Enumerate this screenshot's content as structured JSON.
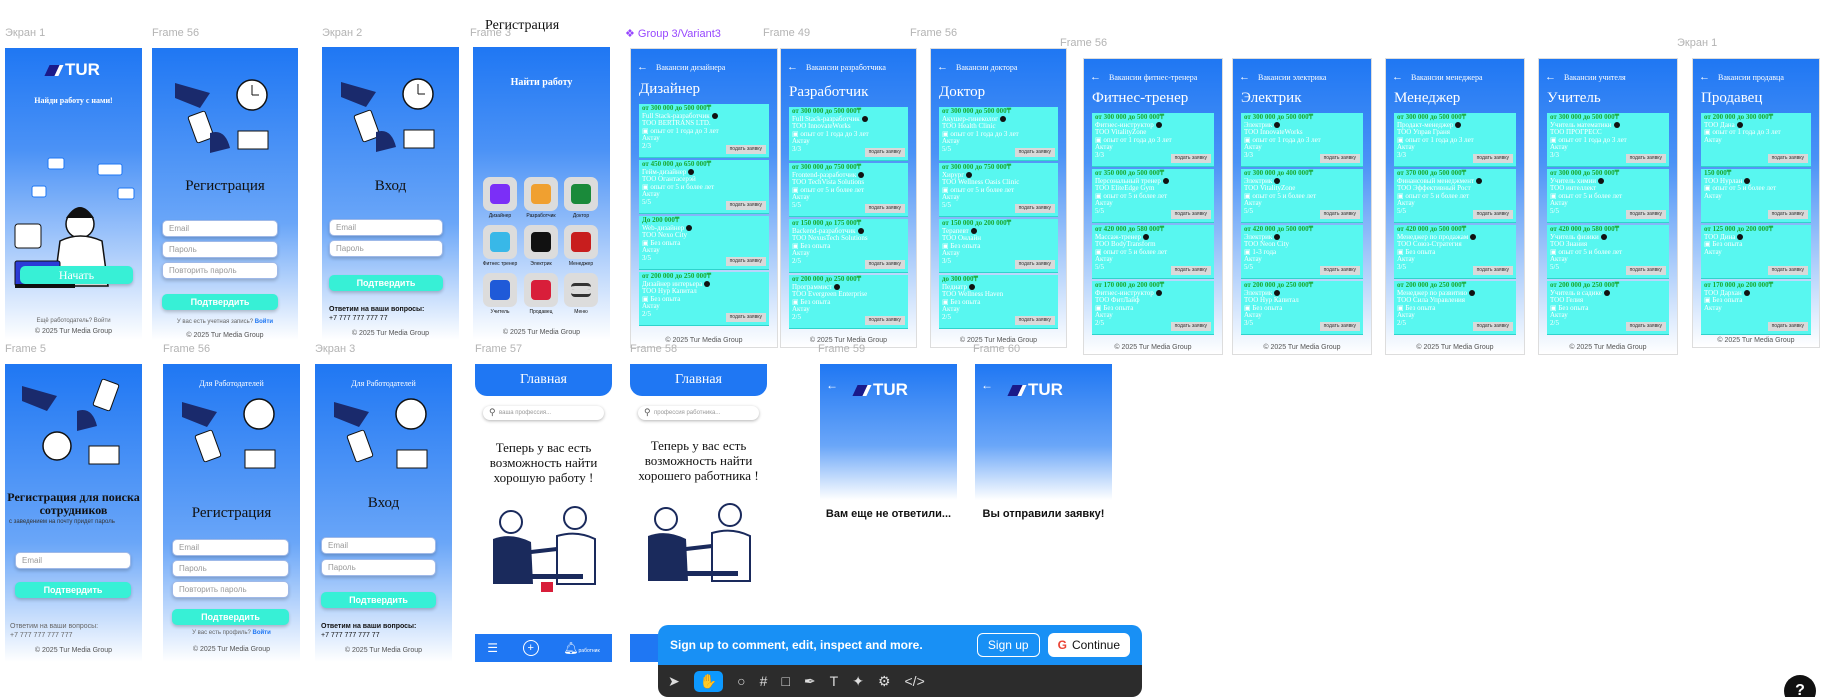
{
  "labels": {
    "ekran1": "Экран 1",
    "frame56a": "Frame 56",
    "ekran2": "Экран 2",
    "frame3": "Frame 3",
    "registration_top": "Регистрация",
    "group3": "❖ Group 3/Variant3",
    "frame49": "Frame 49",
    "frame56b": "Frame 56",
    "frame56c": "Frame 56",
    "ekran1b": "Экран 1",
    "frame5": "Frame 5",
    "frame56d": "Frame 56",
    "ekran3": "Экран 3",
    "frame57": "Frame 57",
    "frame58": "Frame 58",
    "frame59": "Frame 59",
    "frame60": "Frame 60"
  },
  "welcome": {
    "logo": "TUR",
    "headline": "Найди работу с нами!",
    "start": "Начать",
    "footnote": "Ещё работодатель? Войти",
    "copyright": "© 2025 Tur Media Group"
  },
  "register1": {
    "title": "Регистрация",
    "email": "Email",
    "password": "Пароль",
    "repeat": "Повторить пароль",
    "confirm": "Подтвердить",
    "have_account": "У вас есть учетная запись?",
    "login_link": "Войти",
    "copyright": "© 2025 Tur Media Group"
  },
  "login1": {
    "title": "Вход",
    "email": "Email",
    "password": "Пароль",
    "confirm": "Подтвердить",
    "contact": "Ответим на ваши вопросы:",
    "phone": "+7 777 777 777 77",
    "copyright": "© 2025 Tur Media Group"
  },
  "categories": {
    "find": "Найти работу",
    "items": [
      {
        "label": "Дизайнер",
        "icon": "pencil-ruler-icon",
        "color": "#7b2ff7"
      },
      {
        "label": "Разработчик",
        "icon": "code-icon",
        "color": "#f0a030"
      },
      {
        "label": "Доктор",
        "icon": "stethoscope-icon",
        "color": "#1a8a3a"
      },
      {
        "label": "Фитнес тренер",
        "icon": "dumbbell-icon",
        "color": "#38b8e8"
      },
      {
        "label": "Электрик",
        "icon": "switch-icon",
        "color": "#111111"
      },
      {
        "label": "Менеджер",
        "icon": "bank-icon",
        "color": "#c81e1e"
      },
      {
        "label": "Учитель",
        "icon": "teacher-icon",
        "color": "#1f5ad8"
      },
      {
        "label": "Продавец",
        "icon": "receipt-icon",
        "color": "#d81e3a"
      },
      {
        "label": "Меню",
        "icon": "menu-icon",
        "color": "#333333"
      }
    ],
    "copyright": "© 2025 Tur Media Group"
  },
  "jobs": [
    {
      "header": "Вакансии дизайнера",
      "title": "Дизайнер",
      "cards": [
        {
          "salary": "от 300 000 до 500 000₸",
          "role": "Full Stack-разработчик",
          "company": "ТОО BERTRANS LTD.",
          "exp": "опыт от 1 года до 3 лет",
          "city": "Актау",
          "count": "2/3"
        },
        {
          "salary": "от 450 000 до 650 000₸",
          "role": "Гейм-дизайнер",
          "company": "ТОО Огантасерэй",
          "exp": "опыт от 5 и более лет",
          "city": "Актау",
          "count": "5/5"
        },
        {
          "salary": "До 200 000₸",
          "role": "Web-дизайнер",
          "company": "ТОО Nexo City",
          "exp": "Без опыта",
          "city": "Актау",
          "count": "3/5"
        },
        {
          "salary": "от 200 000 до 250 000₸",
          "role": "Дизайнер интерьера",
          "company": "ТОО Нур Капитал",
          "exp": "Без опыта",
          "city": "Актау",
          "count": "2/5"
        }
      ]
    },
    {
      "header": "Вакансии разработчика",
      "title": "Разработчик",
      "cards": [
        {
          "salary": "от 300 000 до 500 000₸",
          "role": "Full Stack-разработчик",
          "company": "ТОО InnovateWorks",
          "exp": "опыт от 1 года до 3 лет",
          "city": "Актау",
          "count": "3/3"
        },
        {
          "salary": "от 300 000 до 750 000₸",
          "role": "Frontend-разработчик",
          "company": "ТОО TechVista Solutions",
          "exp": "опыт от 5 и более лет",
          "city": "Актау",
          "count": "5/5"
        },
        {
          "salary": "от 150 000 до 175 000₸",
          "role": "Backend-разработчик",
          "company": "ТОО NexusTech Solutions",
          "exp": "Без опыта",
          "city": "Актау",
          "count": "2/5"
        },
        {
          "salary": "от 200 000 до 250 000₸",
          "role": "Программист",
          "company": "ТОО Evergreen Enterprise",
          "exp": "Без опыта",
          "city": "Актау",
          "count": "2/5"
        }
      ]
    },
    {
      "header": "Вакансии доктора",
      "title": "Доктор",
      "cards": [
        {
          "salary": "от 300 000 до 500 000₸",
          "role": "Акушер-гинеколог",
          "company": "ТОО Health Clinic",
          "exp": "опыт от 1 года до 3 лет",
          "city": "Актау",
          "count": "5/5"
        },
        {
          "salary": "от 300 000 до 750 000₸",
          "role": "Хирург",
          "company": "ТОО Wellness Oasis Clinic",
          "exp": "опыт от 5 и более лет",
          "city": "Актау",
          "count": "5/5"
        },
        {
          "salary": "от 150 000 до 200 000₸",
          "role": "Терапевт",
          "company": "ТОО Онлайн",
          "exp": "Без опыта",
          "city": "Актау",
          "count": "3/5"
        },
        {
          "salary": "до 300 000₸",
          "role": "Педиатр",
          "company": "ТОО Wellness Haven",
          "exp": "Без опыта",
          "city": "Актау",
          "count": "2/5"
        }
      ]
    },
    {
      "header": "Вакансии фитнес-тренера",
      "title": "Фитнес-тренер",
      "cards": [
        {
          "salary": "от 300 000 до 500 000₸",
          "role": "Фитнес-инструктор",
          "company": "ТОО VitalityZone",
          "exp": "опыт от 1 года до 3 лет",
          "city": "Актау",
          "count": "3/3"
        },
        {
          "salary": "от 350 000 до 500 000₸",
          "role": "Персональный тренер",
          "company": "ТОО EliteEdge Gym",
          "exp": "опыт от 5 и более лет",
          "city": "Актау",
          "count": "5/5"
        },
        {
          "salary": "от 420 000 до 580 000₸",
          "role": "Массаж-тренер",
          "company": "ТОО BodyTransform",
          "exp": "опыт от 5 и более лет",
          "city": "Актау",
          "count": "5/5"
        },
        {
          "salary": "от 170 000 до 200 000₸",
          "role": "Фитнес-инструктор",
          "company": "ТОО ФитЛайф",
          "exp": "Без опыта",
          "city": "Актау",
          "count": "2/5"
        }
      ]
    },
    {
      "header": "Вакансии электрика",
      "title": "Электрик",
      "cards": [
        {
          "salary": "от 300 000 до 500 000₸",
          "role": "Электрик",
          "company": "ТОО InnovateWorks",
          "exp": "опыт от 1 года до 3 лет",
          "city": "Актау",
          "count": "3/3"
        },
        {
          "salary": "от 300 000 до 400 000₸",
          "role": "Электрик",
          "company": "ТОО VitalityZone",
          "exp": "опыт от 5 и более лет",
          "city": "Актау",
          "count": "5/5"
        },
        {
          "salary": "от 420 000 до 500 000₸",
          "role": "Электрик",
          "company": "ТОО Neon City",
          "exp": "1-3 года",
          "city": "Актау",
          "count": "5/5"
        },
        {
          "salary": "от 200 000 до 250 000₸",
          "role": "Электрик",
          "company": "ТОО Нур Капитал",
          "exp": "Без опыта",
          "city": "Актау",
          "count": "3/5"
        }
      ]
    },
    {
      "header": "Вакансии менеджера",
      "title": "Менеджер",
      "cards": [
        {
          "salary": "от 300 000 до 500 000₸",
          "role": "Продакт-менеджер",
          "company": "ТОО Управ Граня",
          "exp": "опыт от 1 года до 3 лет",
          "city": "Актау",
          "count": "3/3"
        },
        {
          "salary": "от 370 000 до 500 000₸",
          "role": "Финансовый менеджмент",
          "company": "ТОО Эффективный Рост",
          "exp": "опыт от 5 и более лет",
          "city": "Актау",
          "count": "5/5"
        },
        {
          "salary": "от 420 000 до 500 000₸",
          "role": "Менеджер по продажам",
          "company": "ТОО Союз-Стратегия",
          "exp": "Без опыта",
          "city": "Актау",
          "count": "3/5"
        },
        {
          "salary": "от 200 000 до 250 000₸",
          "role": "Менеджер по развитию",
          "company": "ТОО Сила Управления",
          "exp": "Без опыта",
          "city": "Актау",
          "count": "2/5"
        }
      ]
    },
    {
      "header": "Вакансии учителя",
      "title": "Учитель",
      "cards": [
        {
          "salary": "от 300 000 до 500 000₸",
          "role": "Учитель математики",
          "company": "ТОО ПРОГРЕСС",
          "exp": "опыт от 1 года до 3 лет",
          "city": "Актау",
          "count": "3/3"
        },
        {
          "salary": "от 300 000 до 500 000₸",
          "role": "Учитель химии",
          "company": "ТОО интеллект",
          "exp": "опыт от 5 и более лет",
          "city": "Актау",
          "count": "5/5"
        },
        {
          "salary": "от 420 000 до 580 000₸",
          "role": "Учитель физики",
          "company": "ТОО Знания",
          "exp": "опыт от 5 и более лет",
          "city": "Актау",
          "count": "5/5"
        },
        {
          "salary": "от 200 000 до 250 000₸",
          "role": "Учитель в садике",
          "company": "ТОО Гелия",
          "exp": "Без опыта",
          "city": "Актау",
          "count": "2/5"
        }
      ]
    },
    {
      "header": "Вакансии продавца",
      "title": "Продавец",
      "cards": [
        {
          "salary": "от 200 000 до 300 000₸",
          "role": "ТОО Дана",
          "company": "",
          "exp": "опыт от 1 года до 3 лет",
          "city": "Актау",
          "count": ""
        },
        {
          "salary": "150 000₸",
          "role": "ТОО Нурлан",
          "company": "",
          "exp": "опыт от 5 и более лет",
          "city": "Актау",
          "count": ""
        },
        {
          "salary": "от 125 000 до 200 000₸",
          "role": "ТОО Дина",
          "company": "",
          "exp": "Без опыта",
          "city": "Актау",
          "count": ""
        },
        {
          "salary": "от 170 000 до 200 000₸",
          "role": "ТОО Дархан",
          "company": "",
          "exp": "Без опыта",
          "city": "Актау",
          "count": ""
        }
      ]
    }
  ],
  "apply_label": "подать заявку",
  "job_copyright": "© 2025 Tur Media Group",
  "employer_reg": {
    "title": "Регистрация для поиска сотрудников",
    "subtitle": "с заведением на почту придет пароль",
    "email": "Email",
    "confirm": "Подтвердить",
    "contact": "Ответим на ваши вопросы:",
    "phone": "+7 777 777 777 777",
    "copyright": "© 2025 Tur Media Group"
  },
  "employer_register": {
    "header": "Для Работодателей",
    "title": "Регистрация",
    "email": "Email",
    "password": "Пароль",
    "repeat": "Повторить пароль",
    "confirm": "Подтвердить",
    "have_account": "У вас есть профиль?",
    "login_link": "Войти",
    "copyright": "© 2025 Tur Media Group"
  },
  "employer_login": {
    "header": "Для Работодателей",
    "title": "Вход",
    "email": "Email",
    "password": "Пароль",
    "confirm": "Подтвердить",
    "contact": "Ответим на ваши вопросы:",
    "phone": "+7 777 777 777 77",
    "copyright": "© 2025 Tur Media Group"
  },
  "main57": {
    "title": "Главная",
    "search": "ваша профессия...",
    "message": "Теперь у вас есть возможность найти хорошую работу !",
    "nav_label": "работник"
  },
  "main58": {
    "title": "Главная",
    "search": "профессия работника...",
    "message": "Теперь у вас есть возможность найти хорошего работника !"
  },
  "f59": {
    "logo": "TUR",
    "message": "Вам еще не ответили..."
  },
  "f60": {
    "logo": "TUR",
    "message": "Вы отправили заявку!"
  },
  "toolbar": {
    "banner": "Sign up to comment, edit, inspect and more.",
    "signup": "Sign up",
    "continue": "Continue"
  },
  "help": "?"
}
